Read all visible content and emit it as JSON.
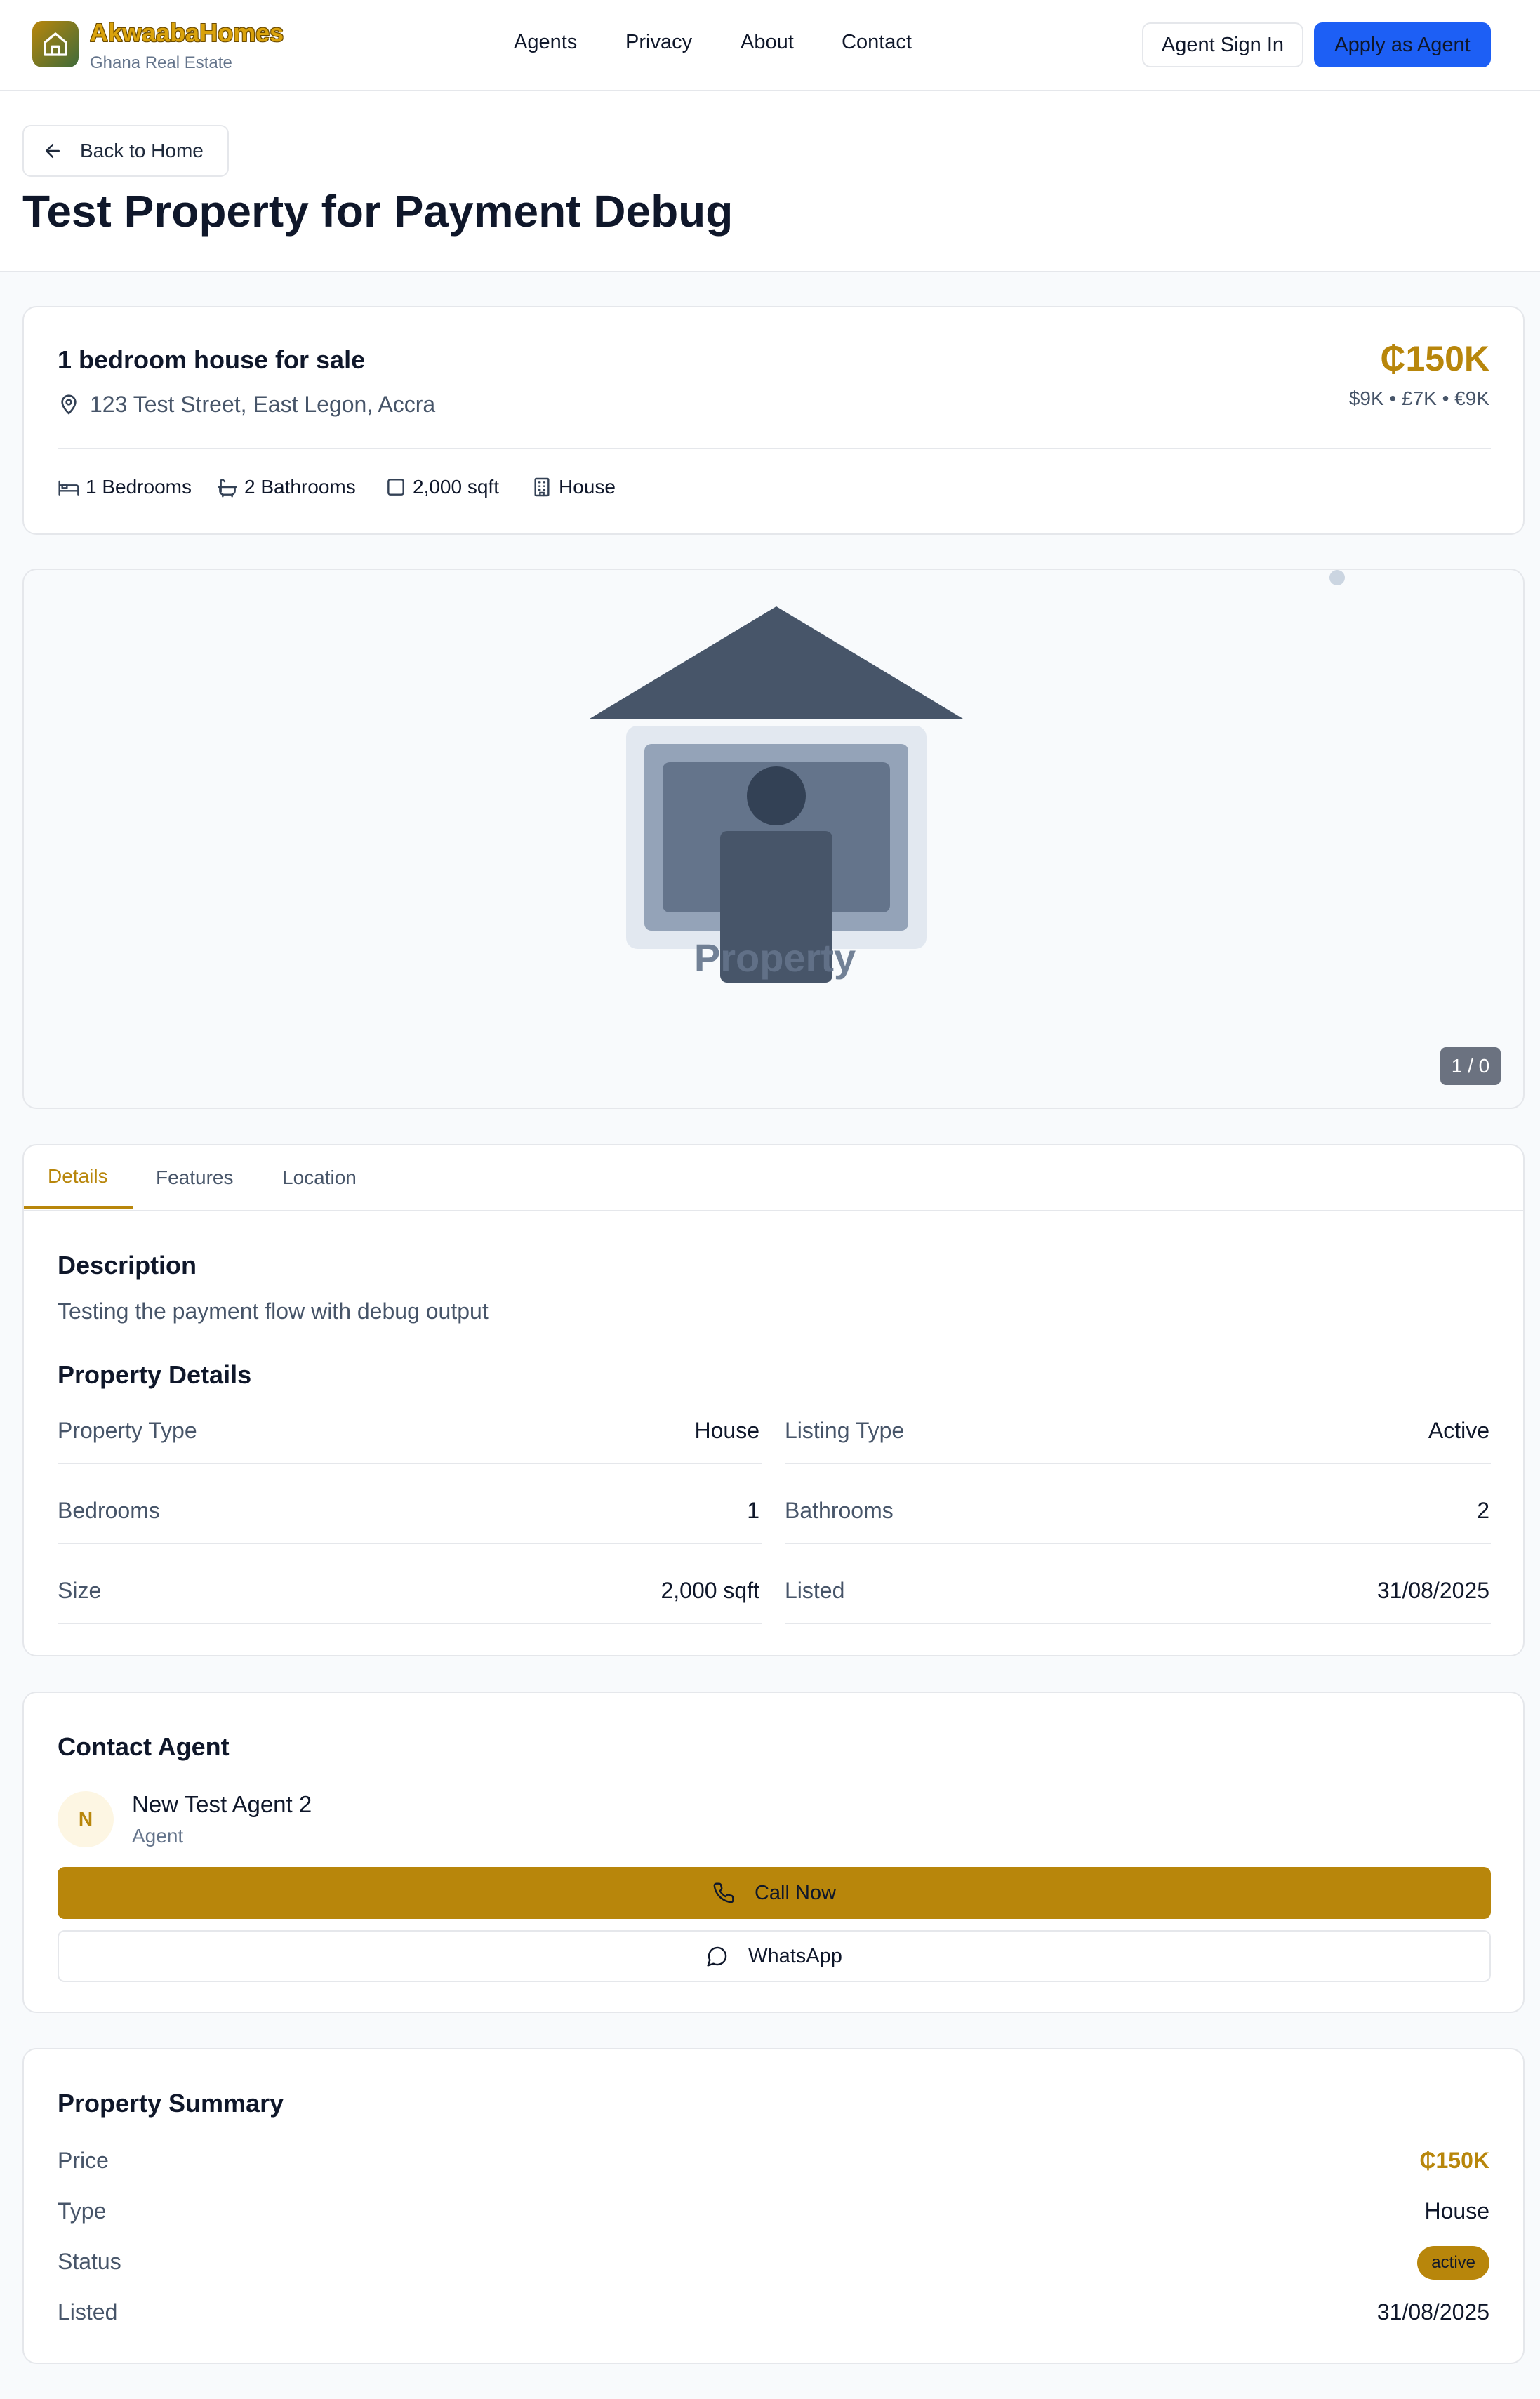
{
  "header": {
    "brand": "AkwaabaHomes",
    "brand_sub": "Ghana Real Estate",
    "nav": [
      "Agents",
      "Privacy",
      "About",
      "Contact"
    ],
    "signin_label": "Agent Sign In",
    "apply_label": "Apply as Agent"
  },
  "titlebar": {
    "back_label": "Back to Home",
    "title": "Test Property for Payment Debug"
  },
  "overview": {
    "heading": "1 bedroom house for sale",
    "address": "123 Test Street, East Legon, Accra",
    "price": "₵150K",
    "price_alt": "$9K • £7K • €9K",
    "stats": {
      "bedrooms": "1 Bedrooms",
      "bathrooms": "2 Bathrooms",
      "size": "2,000 sqft",
      "type": "House"
    }
  },
  "gallery": {
    "placeholder_text": "Property",
    "counter": "1 / 0"
  },
  "tabs": {
    "details": "Details",
    "features": "Features",
    "location": "Location"
  },
  "details": {
    "description_heading": "Description",
    "description": "Testing the payment flow with debug output",
    "property_details_heading": "Property Details",
    "rows": [
      {
        "label": "Property Type",
        "value": "House"
      },
      {
        "label": "Listing Type",
        "value": "Active"
      },
      {
        "label": "Bedrooms",
        "value": "1"
      },
      {
        "label": "Bathrooms",
        "value": "2"
      },
      {
        "label": "Size",
        "value": "2,000 sqft"
      },
      {
        "label": "Listed",
        "value": "31/08/2025"
      }
    ]
  },
  "contact": {
    "heading": "Contact Agent",
    "avatar_initial": "N",
    "agent_name": "New Test Agent 2",
    "agent_role": "Agent",
    "call_label": "Call Now",
    "whatsapp_label": "WhatsApp"
  },
  "summary": {
    "heading": "Property Summary",
    "price_label": "Price",
    "price_value": "₵150K",
    "type_label": "Type",
    "type_value": "House",
    "status_label": "Status",
    "status_value": "active",
    "listed_label": "Listed",
    "listed_value": "31/08/2025"
  },
  "colors": {
    "accent": "#b8860b",
    "primary_blue": "#1d5ff5",
    "text_dark": "#0f172a",
    "text_muted": "#475569"
  }
}
